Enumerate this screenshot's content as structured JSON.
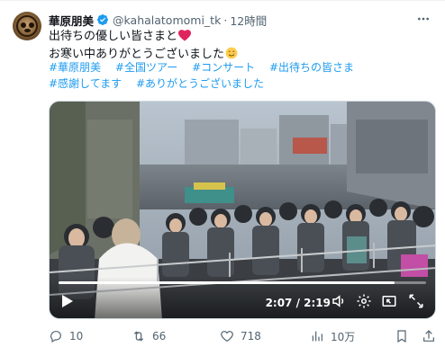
{
  "author": {
    "name": "華原朋美",
    "handle": "@kahalatomomi_tk",
    "separator": "·",
    "time": "12時間",
    "avatar_icon": "profile-photo",
    "verified_icon": "verified-badge-icon"
  },
  "tweet": {
    "line1": "出待ちの優しい皆さまと",
    "line1_emoji": "heart",
    "line2": "お寒い中ありがとうございました",
    "line2_emoji": "smiling-face-with-tear",
    "hashtags": [
      "#華原朋美",
      "#全国ツアー",
      "#コンサート",
      "#出待ちの皆さま",
      "#感謝してます",
      "#ありがとうございました"
    ]
  },
  "video": {
    "elapsed": "2:07",
    "duration": "2:19",
    "time_display": "2:07 / 2:19",
    "progress_fraction": 0.913,
    "controls": [
      "play-icon",
      "volume-icon",
      "settings-gear-icon",
      "picture-in-picture-icon",
      "fullscreen-icon"
    ]
  },
  "actions": {
    "replies": "10",
    "reposts": "66",
    "likes": "718",
    "views": "10万"
  },
  "colors": {
    "link": "#1d9bf0",
    "muted": "#536471",
    "text": "#0f1419",
    "verified": "#1d9bf0",
    "heart": "#e0245e"
  }
}
